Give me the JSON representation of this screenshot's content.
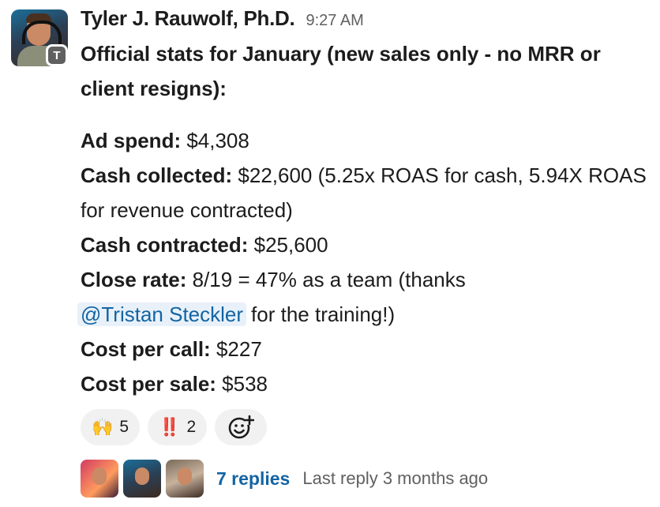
{
  "message": {
    "sender": "Tyler J. Rauwolf, Ph.D.",
    "time": "9:27 AM",
    "avatar_badge": "T",
    "intro": "Official stats for January (new sales only - no MRR or client resigns):",
    "lines": {
      "ad_spend": {
        "label": "Ad spend:",
        "value": " $4,308"
      },
      "cash_collected": {
        "label": "Cash collected:",
        "value": " $22,600 (5.25x ROAS for cash, 5.94X ROAS for revenue contracted)"
      },
      "cash_contracted": {
        "label": "Cash contracted:",
        "value": " $25,600"
      },
      "close_rate": {
        "label": "Close rate:",
        "value": " 8/19 = 47% as a team (thanks",
        "mention": "@Tristan Steckler",
        "after": "for the training!)"
      },
      "cost_per_call": {
        "label": "Cost per call:",
        "value": " $227"
      },
      "cost_per_sale": {
        "label": "Cost per sale:",
        "value": " $538"
      }
    }
  },
  "reactions": [
    {
      "emoji": "🙌",
      "count": "5"
    },
    {
      "emoji": "‼️",
      "count": "2"
    }
  ],
  "add_reaction_icon": "add-reaction-icon",
  "thread": {
    "replies": "7 replies",
    "last_reply": "Last reply 3 months ago"
  }
}
